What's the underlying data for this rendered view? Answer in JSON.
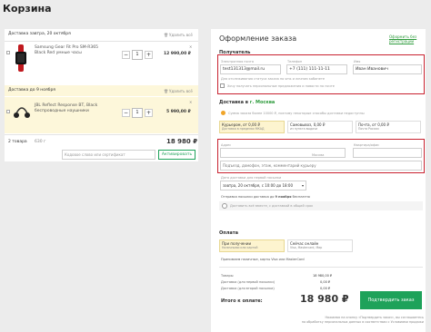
{
  "page_title": "Корзина",
  "cart": {
    "group1": {
      "heading": "Доставка завтра, 20 октября",
      "clear": "Удалить всё"
    },
    "item1": {
      "name_lines": [
        "Samsung Gear Fit Pro SM-R365",
        "Black Red умные часы"
      ],
      "qty": "1",
      "price": "12 990,00 ₽"
    },
    "group2": {
      "heading": "Доставка до 9 ноября",
      "clear": "Удалить всё"
    },
    "item2": {
      "name_lines": [
        "JBL Reflect Response BT, Black",
        "беспроводные наушники"
      ],
      "qty": "1",
      "price": "5 990,00 ₽"
    },
    "summary": {
      "count": "2 товара",
      "weight": "630 г",
      "total": "18 980 ₽"
    },
    "promo": {
      "placeholder": "Кодовое слово или сертификат",
      "apply": "Активировать"
    }
  },
  "checkout": {
    "title": "Оформление заказа",
    "link": "Оформить без регистрации",
    "recipient": {
      "heading": "Получатель",
      "email_label": "Электронная почта",
      "email_value": "test131313@mail.ru",
      "phone_label": "Телефон",
      "phone_value": "+7 (111) 111-11-11",
      "name_label": "Имя",
      "name_value": "Иван Иванович",
      "hint": "Для отслеживания статуса заказа по sms и личном кабинете",
      "subscribe": "Хочу получать персональные предложения и новости по почте"
    },
    "delivery": {
      "heading": "Доставка в",
      "city": "г. Москва",
      "note": "Сумма заказа более 10000 ₽, поэтому некоторые способы доставки недоступны",
      "options": [
        {
          "title": "Курьером, от 0,00 ₽",
          "sub": "Доставка в пределах МКАД"
        },
        {
          "title": "Самовывоз, 0,00 ₽",
          "sub": "из пункта выдачи"
        },
        {
          "title": "Почта, от 0,00 ₽",
          "sub": "Почта России"
        }
      ],
      "address_label": "Адрес",
      "address_hint": "Москва",
      "apt_label": "Квартира/офис",
      "comment_placeholder": "Подъезд, домофон, этаж, комментарий курьеру",
      "date_label": "Дата доставки для первой посылки",
      "date_value": "завтра, 20 октября, с 10:00 до 18:00",
      "split_note_a": "Отправка посылки доставка до",
      "split_note_b": "9 ноября",
      "split_note_c": "бесплатно",
      "split_check": "Доставить всё вместе, с доставкой в общий срок"
    },
    "payment": {
      "heading": "Оплата",
      "options": [
        {
          "title": "При получении",
          "sub": "Наличными или картой"
        },
        {
          "title": "Сейчас онлайн",
          "sub": "Visa, Mastercard, Мир"
        }
      ],
      "accept_note": "Принимаем наличные, карты Visa или MasterCard"
    },
    "totals": {
      "goods_label": "Товары",
      "goods_value": "18 980,00 ₽",
      "delivery1_label": "Доставка (для первой посылки)",
      "delivery1_value": "0,00 ₽",
      "delivery2_label": "Доставка (для второй посылки)",
      "delivery2_value": "0,00 ₽",
      "total_label": "Итого к оплате:",
      "total_value": "18 980 ₽",
      "confirm": "Подтвердить заказ",
      "legal1": "Нажимая на кнопку «Подтвердить заказ», вы соглашаетесь",
      "legal2": "на обработку персональных данных в соответствии с Условиями продажи"
    }
  },
  "colors": {
    "accent": "#1ea25a",
    "highlight": "#c8212f",
    "yellow_band": "#fdf7da"
  }
}
